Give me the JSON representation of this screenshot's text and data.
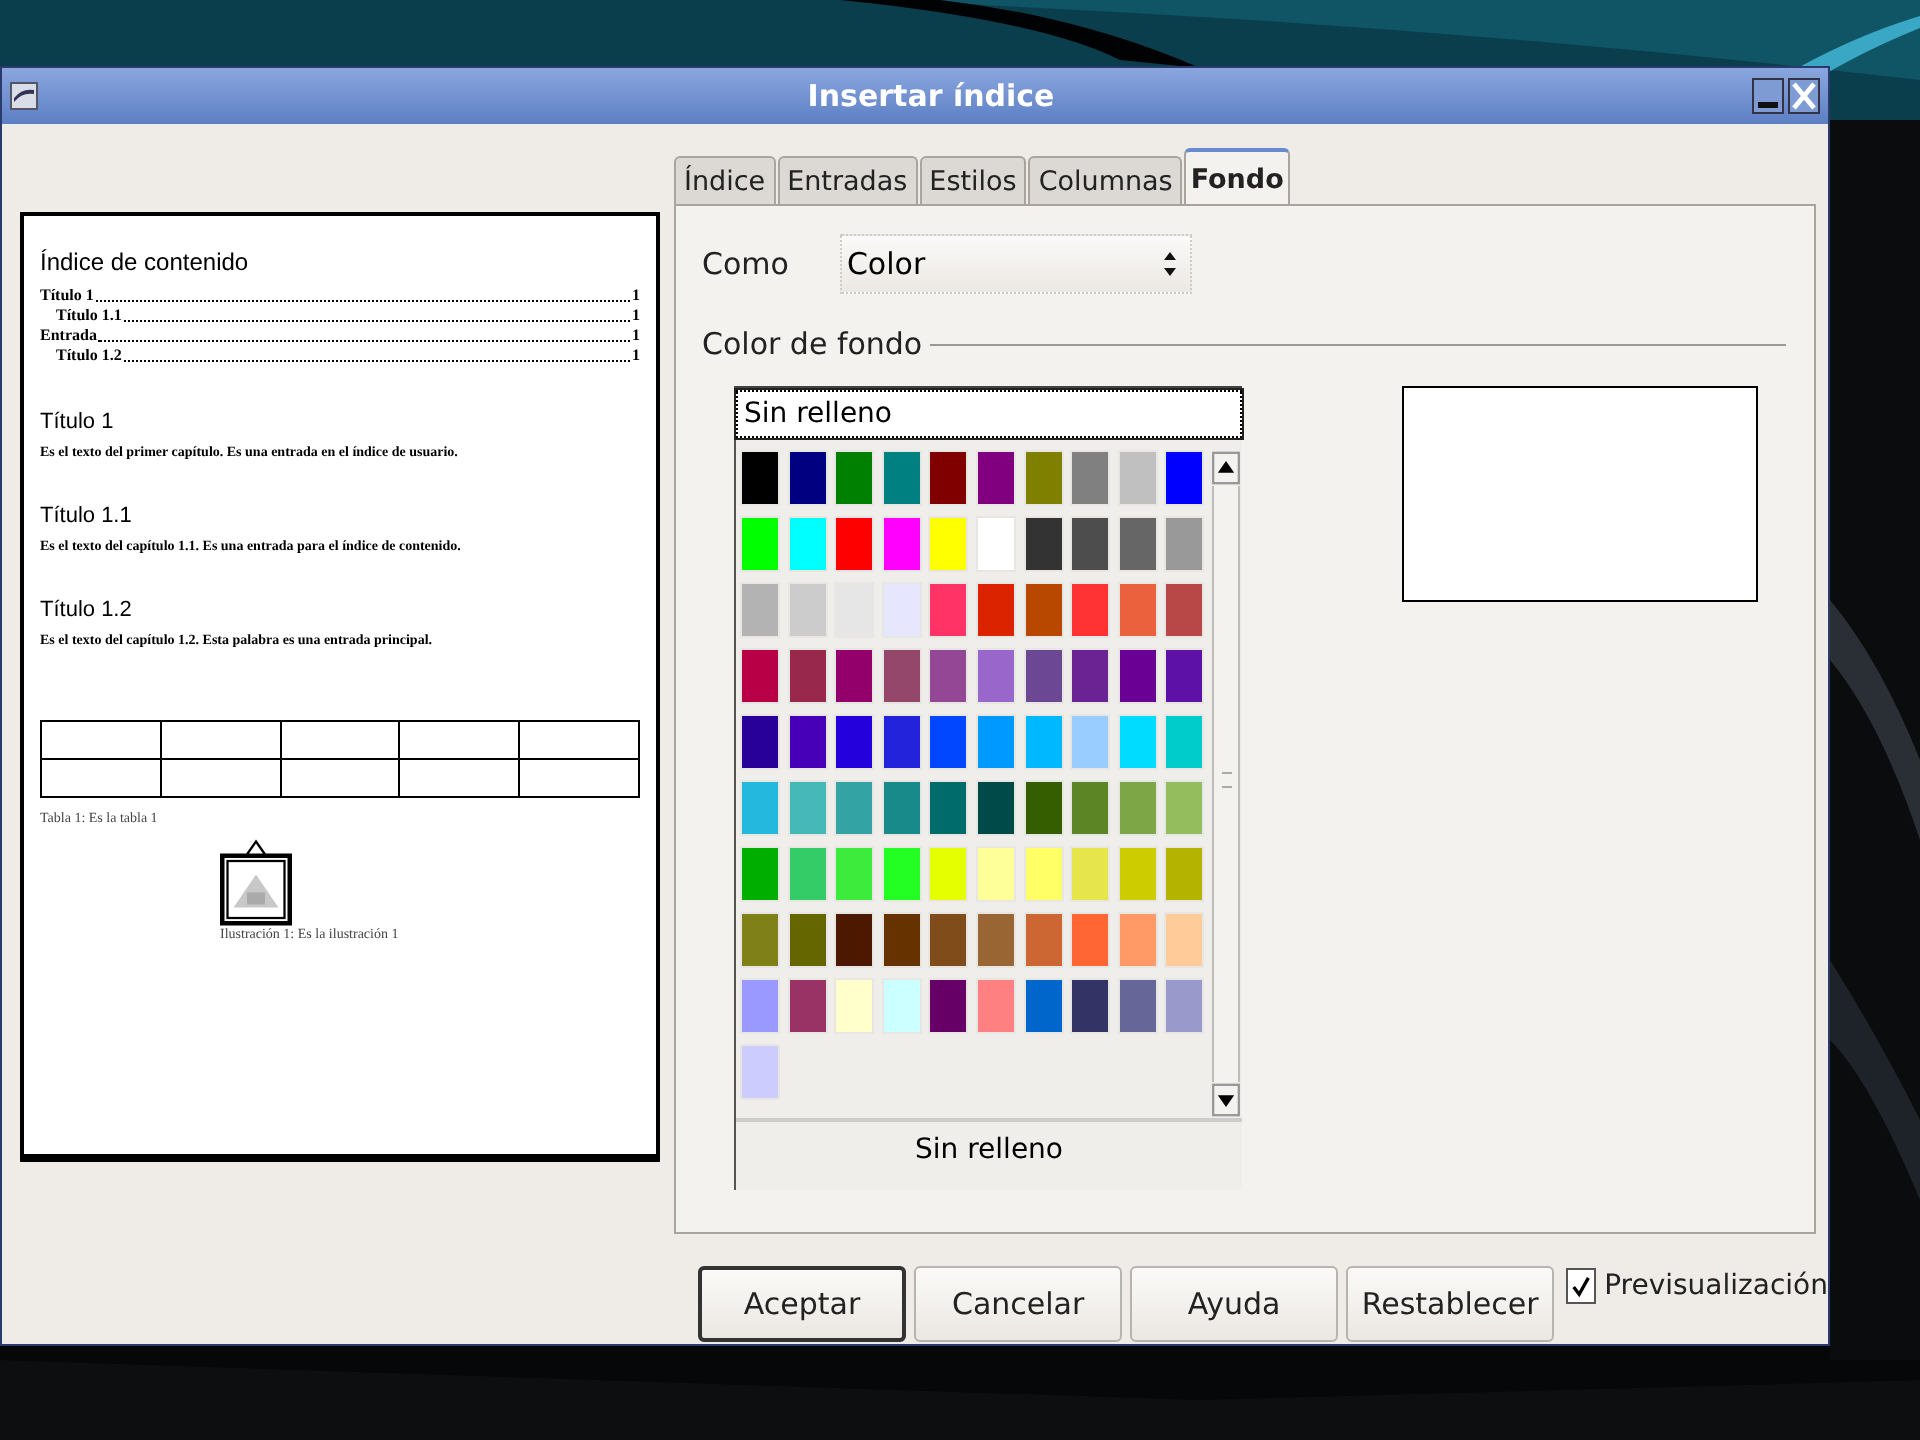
{
  "window": {
    "title": "Insertar índice"
  },
  "preview": {
    "toc_title": "Índice de contenido",
    "toc": [
      {
        "text": "Título 1",
        "page": "1",
        "children": [
          {
            "text": "Título 1.1",
            "page": "1"
          }
        ]
      },
      {
        "text": "Entrada",
        "page": "1",
        "children": [
          {
            "text": "Título 1.2",
            "page": "1"
          }
        ]
      }
    ],
    "sections": [
      {
        "heading": "Título 1",
        "body": "Es el texto del primer capítulo. Es una entrada en el índice de usuario."
      },
      {
        "heading": "Título 1.1",
        "body": "Es el texto del capítulo 1.1. Es una entrada para el índice de contenido."
      },
      {
        "heading": "Título 1.2",
        "body": "Es el texto del capítulo 1.2. Esta palabra es una entrada principal."
      }
    ],
    "table_caption": "Tabla 1: Es la tabla 1",
    "figure_caption": "Ilustración 1: Es la ilustración 1"
  },
  "tabs": [
    {
      "label": "Índice",
      "selected": false
    },
    {
      "label": "Entradas",
      "selected": false
    },
    {
      "label": "Estilos",
      "selected": false
    },
    {
      "label": "Columnas",
      "selected": false
    },
    {
      "label": "Fondo",
      "selected": true
    }
  ],
  "background": {
    "type_label": "Como",
    "type_value": "Color",
    "section_label": "Color de fondo",
    "no_fill": {
      "label": "Sin relleno",
      "selected": true
    },
    "swatches": [
      {
        "color": "#000000",
        "selected": false
      },
      {
        "color": "#000080",
        "selected": false
      },
      {
        "color": "#008000",
        "selected": false
      },
      {
        "color": "#008080",
        "selected": false
      },
      {
        "color": "#800000",
        "selected": false
      },
      {
        "color": "#800080",
        "selected": false
      },
      {
        "color": "#808000",
        "selected": false
      },
      {
        "color": "#808080",
        "selected": false
      },
      {
        "color": "#c0c0c0",
        "selected": false
      },
      {
        "color": "#0000ff",
        "selected": false
      },
      {
        "color": "#00ff00",
        "selected": false
      },
      {
        "color": "#00ffff",
        "selected": false
      },
      {
        "color": "#ff0000",
        "selected": false
      },
      {
        "color": "#ff00ff",
        "selected": false
      },
      {
        "color": "#ffff00",
        "selected": false
      },
      {
        "color": "#ffffff",
        "selected": false
      },
      {
        "color": "#333333",
        "selected": false
      },
      {
        "color": "#4d4d4d",
        "selected": false
      },
      {
        "color": "#666666",
        "selected": false
      },
      {
        "color": "#999999",
        "selected": false
      },
      {
        "color": "#b3b3b3",
        "selected": false
      },
      {
        "color": "#cccccc",
        "selected": false
      },
      {
        "color": "#e6e6e6",
        "selected": false
      },
      {
        "color": "#e6e6ff",
        "selected": false
      },
      {
        "color": "#ff3366",
        "selected": false
      },
      {
        "color": "#dc2300",
        "selected": false
      },
      {
        "color": "#b84700",
        "selected": false
      },
      {
        "color": "#ff3333",
        "selected": false
      },
      {
        "color": "#eb613d",
        "selected": false
      },
      {
        "color": "#b84747",
        "selected": false
      },
      {
        "color": "#b80047",
        "selected": false
      },
      {
        "color": "#99284d",
        "selected": false
      },
      {
        "color": "#94006b",
        "selected": false
      },
      {
        "color": "#94476b",
        "selected": false
      },
      {
        "color": "#944794",
        "selected": false
      },
      {
        "color": "#9966cc",
        "selected": false
      },
      {
        "color": "#6b4794",
        "selected": false
      },
      {
        "color": "#6b2394",
        "selected": false
      },
      {
        "color": "#6b0094",
        "selected": false
      },
      {
        "color": "#5e11a6",
        "selected": false
      },
      {
        "color": "#280099",
        "selected": false
      },
      {
        "color": "#4700b8",
        "selected": false
      },
      {
        "color": "#2300dc",
        "selected": false
      },
      {
        "color": "#2323dc",
        "selected": false
      },
      {
        "color": "#0047ff",
        "selected": false
      },
      {
        "color": "#0099ff",
        "selected": false
      },
      {
        "color": "#00b8ff",
        "selected": false
      },
      {
        "color": "#99ccff",
        "selected": false
      },
      {
        "color": "#00dcff",
        "selected": false
      },
      {
        "color": "#00cccc",
        "selected": false
      },
      {
        "color": "#23b8dc",
        "selected": false
      },
      {
        "color": "#47b8b8",
        "selected": false
      },
      {
        "color": "#33a3a3",
        "selected": false
      },
      {
        "color": "#198a8a",
        "selected": false
      },
      {
        "color": "#006b6b",
        "selected": false
      },
      {
        "color": "#004a4a",
        "selected": false
      },
      {
        "color": "#355e00",
        "selected": false
      },
      {
        "color": "#5c8526",
        "selected": false
      },
      {
        "color": "#7da647",
        "selected": false
      },
      {
        "color": "#94bd5e",
        "selected": false
      },
      {
        "color": "#00ae00",
        "selected": false
      },
      {
        "color": "#33cc66",
        "selected": false
      },
      {
        "color": "#3deb3d",
        "selected": false
      },
      {
        "color": "#23ff23",
        "selected": false
      },
      {
        "color": "#e6ff00",
        "selected": false
      },
      {
        "color": "#ffff99",
        "selected": false
      },
      {
        "color": "#ffff66",
        "selected": false
      },
      {
        "color": "#e6e64c",
        "selected": false
      },
      {
        "color": "#cccc00",
        "selected": false
      },
      {
        "color": "#b3b300",
        "selected": false
      },
      {
        "color": "#808019",
        "selected": false
      },
      {
        "color": "#666600",
        "selected": false
      },
      {
        "color": "#4c1900",
        "selected": false
      },
      {
        "color": "#663300",
        "selected": false
      },
      {
        "color": "#804c19",
        "selected": false
      },
      {
        "color": "#996633",
        "selected": false
      },
      {
        "color": "#cc6633",
        "selected": false
      },
      {
        "color": "#ff6633",
        "selected": false
      },
      {
        "color": "#ff9966",
        "selected": false
      },
      {
        "color": "#ffcc99",
        "selected": false
      },
      {
        "color": "#9999ff",
        "selected": false
      },
      {
        "color": "#993366",
        "selected": false
      },
      {
        "color": "#ffffcc",
        "selected": false
      },
      {
        "color": "#ccffff",
        "selected": false
      },
      {
        "color": "#660066",
        "selected": false
      },
      {
        "color": "#ff8080",
        "selected": false
      },
      {
        "color": "#0066cc",
        "selected": false
      },
      {
        "color": "#333366",
        "selected": false
      },
      {
        "color": "#666699",
        "selected": false
      },
      {
        "color": "#9999cc",
        "selected": false
      },
      {
        "color": "#ccccff",
        "selected": false
      }
    ],
    "current_name": "Sin relleno"
  },
  "buttons": [
    {
      "label": "Aceptar",
      "default": true
    },
    {
      "label": "Cancelar",
      "default": false
    },
    {
      "label": "Ayuda",
      "default": false
    },
    {
      "label": "Restablecer",
      "default": false
    }
  ],
  "preview_option": {
    "label": "Previsualización",
    "checked": true
  }
}
